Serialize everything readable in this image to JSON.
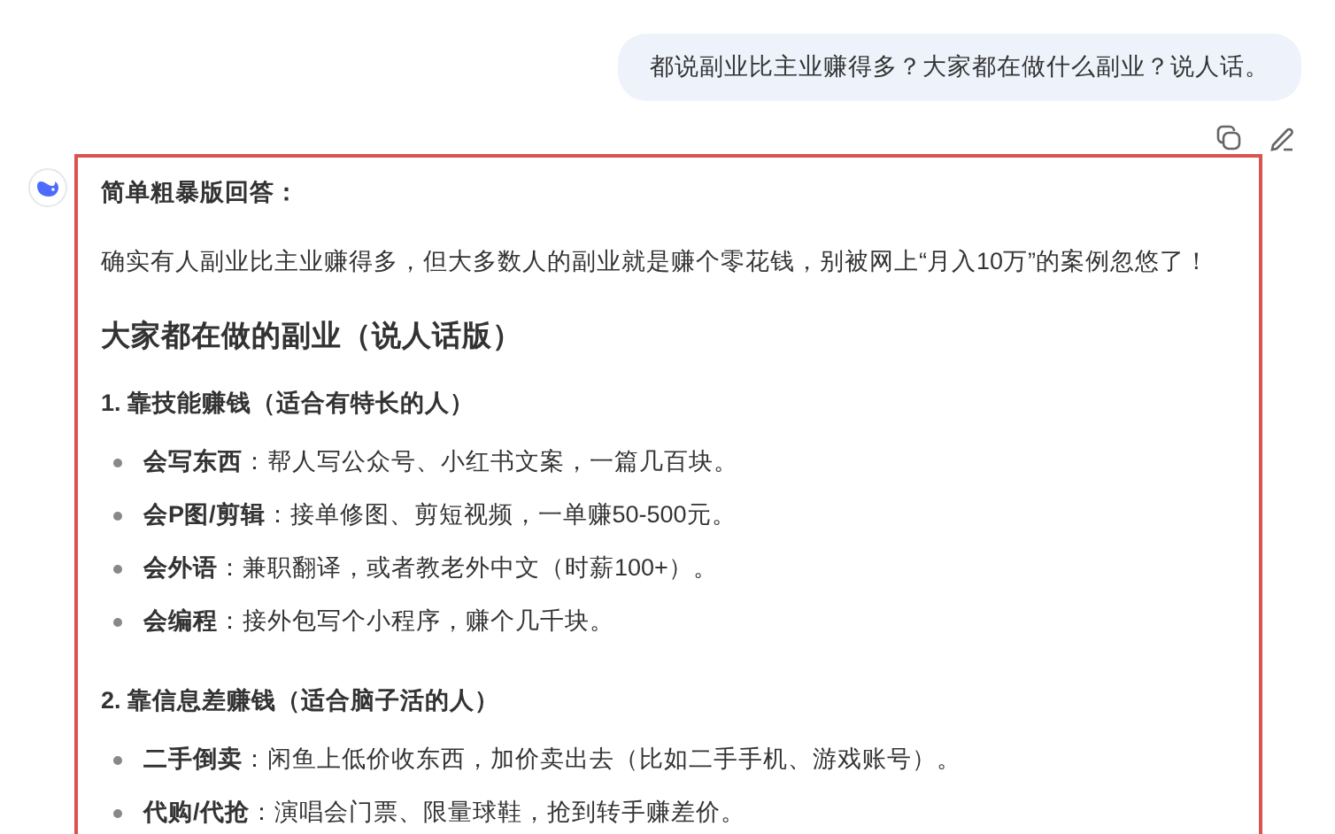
{
  "user_message": {
    "text": "都说副业比主业赚得多？大家都在做什么副业？说人话。"
  },
  "answer": {
    "intro_title": "简单粗暴版回答：",
    "intro_text": "确实有人副业比主业赚得多，但大多数人的副业就是赚个零花钱，别被网上“月入10万”的案例忽悠了！",
    "heading": "大家都在做的副业（说人话版）",
    "sections": [
      {
        "title": "1. 靠技能赚钱（适合有特长的人）",
        "items": [
          "**会写东西**：帮人写公众号、小红书文案，一篇几百块。",
          "**会P图/剪辑**：接单修图、剪短视频，一单赚50-500元。",
          "**会外语**：兼职翻译，或者教老外中文（时薪100+）。",
          "**会编程**：接外包写个小程序，赚个几千块。"
        ]
      },
      {
        "title": "2. 靠信息差赚钱（适合脑子活的人）",
        "items": [
          "**二手倒卖**：闲鱼上低价收东西，加价卖出去（比如二手手机、游戏账号）。",
          "**代购/代抢**：演唱会门票、限量球鞋，抢到转手赚差价。"
        ]
      }
    ]
  }
}
